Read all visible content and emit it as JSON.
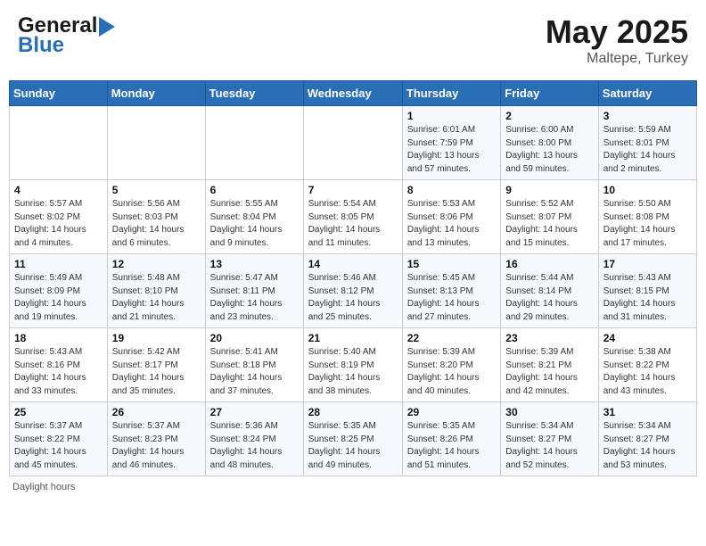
{
  "header": {
    "logo_text": "General",
    "logo_blue": "Blue",
    "title": "May 2025",
    "location": "Maltepe, Turkey"
  },
  "weekdays": [
    "Sunday",
    "Monday",
    "Tuesday",
    "Wednesday",
    "Thursday",
    "Friday",
    "Saturday"
  ],
  "weeks": [
    [
      {
        "day": "",
        "info": ""
      },
      {
        "day": "",
        "info": ""
      },
      {
        "day": "",
        "info": ""
      },
      {
        "day": "",
        "info": ""
      },
      {
        "day": "1",
        "info": "Sunrise: 6:01 AM\nSunset: 7:59 PM\nDaylight: 13 hours\nand 57 minutes."
      },
      {
        "day": "2",
        "info": "Sunrise: 6:00 AM\nSunset: 8:00 PM\nDaylight: 13 hours\nand 59 minutes."
      },
      {
        "day": "3",
        "info": "Sunrise: 5:59 AM\nSunset: 8:01 PM\nDaylight: 14 hours\nand 2 minutes."
      }
    ],
    [
      {
        "day": "4",
        "info": "Sunrise: 5:57 AM\nSunset: 8:02 PM\nDaylight: 14 hours\nand 4 minutes."
      },
      {
        "day": "5",
        "info": "Sunrise: 5:56 AM\nSunset: 8:03 PM\nDaylight: 14 hours\nand 6 minutes."
      },
      {
        "day": "6",
        "info": "Sunrise: 5:55 AM\nSunset: 8:04 PM\nDaylight: 14 hours\nand 9 minutes."
      },
      {
        "day": "7",
        "info": "Sunrise: 5:54 AM\nSunset: 8:05 PM\nDaylight: 14 hours\nand 11 minutes."
      },
      {
        "day": "8",
        "info": "Sunrise: 5:53 AM\nSunset: 8:06 PM\nDaylight: 14 hours\nand 13 minutes."
      },
      {
        "day": "9",
        "info": "Sunrise: 5:52 AM\nSunset: 8:07 PM\nDaylight: 14 hours\nand 15 minutes."
      },
      {
        "day": "10",
        "info": "Sunrise: 5:50 AM\nSunset: 8:08 PM\nDaylight: 14 hours\nand 17 minutes."
      }
    ],
    [
      {
        "day": "11",
        "info": "Sunrise: 5:49 AM\nSunset: 8:09 PM\nDaylight: 14 hours\nand 19 minutes."
      },
      {
        "day": "12",
        "info": "Sunrise: 5:48 AM\nSunset: 8:10 PM\nDaylight: 14 hours\nand 21 minutes."
      },
      {
        "day": "13",
        "info": "Sunrise: 5:47 AM\nSunset: 8:11 PM\nDaylight: 14 hours\nand 23 minutes."
      },
      {
        "day": "14",
        "info": "Sunrise: 5:46 AM\nSunset: 8:12 PM\nDaylight: 14 hours\nand 25 minutes."
      },
      {
        "day": "15",
        "info": "Sunrise: 5:45 AM\nSunset: 8:13 PM\nDaylight: 14 hours\nand 27 minutes."
      },
      {
        "day": "16",
        "info": "Sunrise: 5:44 AM\nSunset: 8:14 PM\nDaylight: 14 hours\nand 29 minutes."
      },
      {
        "day": "17",
        "info": "Sunrise: 5:43 AM\nSunset: 8:15 PM\nDaylight: 14 hours\nand 31 minutes."
      }
    ],
    [
      {
        "day": "18",
        "info": "Sunrise: 5:43 AM\nSunset: 8:16 PM\nDaylight: 14 hours\nand 33 minutes."
      },
      {
        "day": "19",
        "info": "Sunrise: 5:42 AM\nSunset: 8:17 PM\nDaylight: 14 hours\nand 35 minutes."
      },
      {
        "day": "20",
        "info": "Sunrise: 5:41 AM\nSunset: 8:18 PM\nDaylight: 14 hours\nand 37 minutes."
      },
      {
        "day": "21",
        "info": "Sunrise: 5:40 AM\nSunset: 8:19 PM\nDaylight: 14 hours\nand 38 minutes."
      },
      {
        "day": "22",
        "info": "Sunrise: 5:39 AM\nSunset: 8:20 PM\nDaylight: 14 hours\nand 40 minutes."
      },
      {
        "day": "23",
        "info": "Sunrise: 5:39 AM\nSunset: 8:21 PM\nDaylight: 14 hours\nand 42 minutes."
      },
      {
        "day": "24",
        "info": "Sunrise: 5:38 AM\nSunset: 8:22 PM\nDaylight: 14 hours\nand 43 minutes."
      }
    ],
    [
      {
        "day": "25",
        "info": "Sunrise: 5:37 AM\nSunset: 8:22 PM\nDaylight: 14 hours\nand 45 minutes."
      },
      {
        "day": "26",
        "info": "Sunrise: 5:37 AM\nSunset: 8:23 PM\nDaylight: 14 hours\nand 46 minutes."
      },
      {
        "day": "27",
        "info": "Sunrise: 5:36 AM\nSunset: 8:24 PM\nDaylight: 14 hours\nand 48 minutes."
      },
      {
        "day": "28",
        "info": "Sunrise: 5:35 AM\nSunset: 8:25 PM\nDaylight: 14 hours\nand 49 minutes."
      },
      {
        "day": "29",
        "info": "Sunrise: 5:35 AM\nSunset: 8:26 PM\nDaylight: 14 hours\nand 51 minutes."
      },
      {
        "day": "30",
        "info": "Sunrise: 5:34 AM\nSunset: 8:27 PM\nDaylight: 14 hours\nand 52 minutes."
      },
      {
        "day": "31",
        "info": "Sunrise: 5:34 AM\nSunset: 8:27 PM\nDaylight: 14 hours\nand 53 minutes."
      }
    ]
  ],
  "footer": "Daylight hours"
}
